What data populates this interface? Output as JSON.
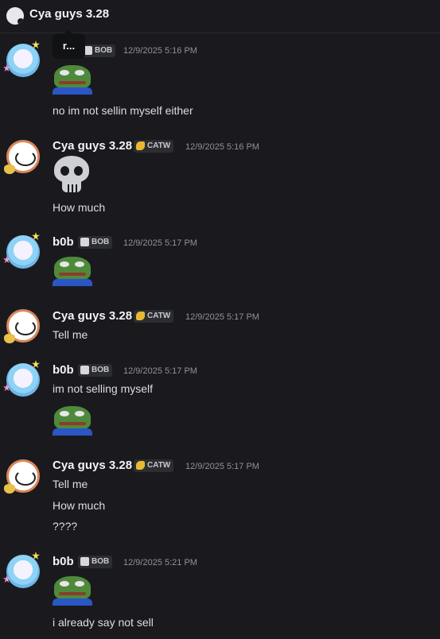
{
  "header": {
    "title": "Cya guys 3.28"
  },
  "tooltip": {
    "text": "r..."
  },
  "messages": [
    {
      "name": "",
      "tag": "BOB",
      "time": "12/9/2025 5:16 PM",
      "lines": [
        "no im not sellin myself either"
      ]
    },
    {
      "name": "Cya guys 3.28",
      "tag": "CATW",
      "time": "12/9/2025 5:16 PM",
      "lines": [
        "How much"
      ]
    },
    {
      "name": "b0b",
      "tag": "BOB",
      "time": "12/9/2025 5:17 PM",
      "lines": []
    },
    {
      "name": "Cya guys 3.28",
      "tag": "CATW",
      "time": "12/9/2025 5:17 PM",
      "lines": [
        "Tell me"
      ]
    },
    {
      "name": "b0b",
      "tag": "BOB",
      "time": "12/9/2025 5:17 PM",
      "lines": [
        "im not selling myself"
      ]
    },
    {
      "name": "Cya guys 3.28",
      "tag": "CATW",
      "time": "12/9/2025 5:17 PM",
      "lines": [
        "Tell me",
        "How much",
        "????"
      ]
    },
    {
      "name": "b0b",
      "tag": "BOB",
      "time": "12/9/2025 5:21 PM",
      "lines": [
        "i already say not sell"
      ]
    }
  ],
  "icons": {
    "guild_icon": "server-icon",
    "bob_avatar": "user-avatar-bob",
    "cya_avatar": "user-avatar-cya",
    "bob_tag_icon": "cat-tag-icon",
    "catw_tag_icon": "coin-tag-icon",
    "frog_emoji": "pepe-frog-emoji",
    "skull_emoji": "skull-emoji"
  },
  "colors": {
    "background": "#1a1a1e",
    "name": "#f2f3f5",
    "timestamp": "#8e9297",
    "tag_bg": "#2b2d31"
  }
}
